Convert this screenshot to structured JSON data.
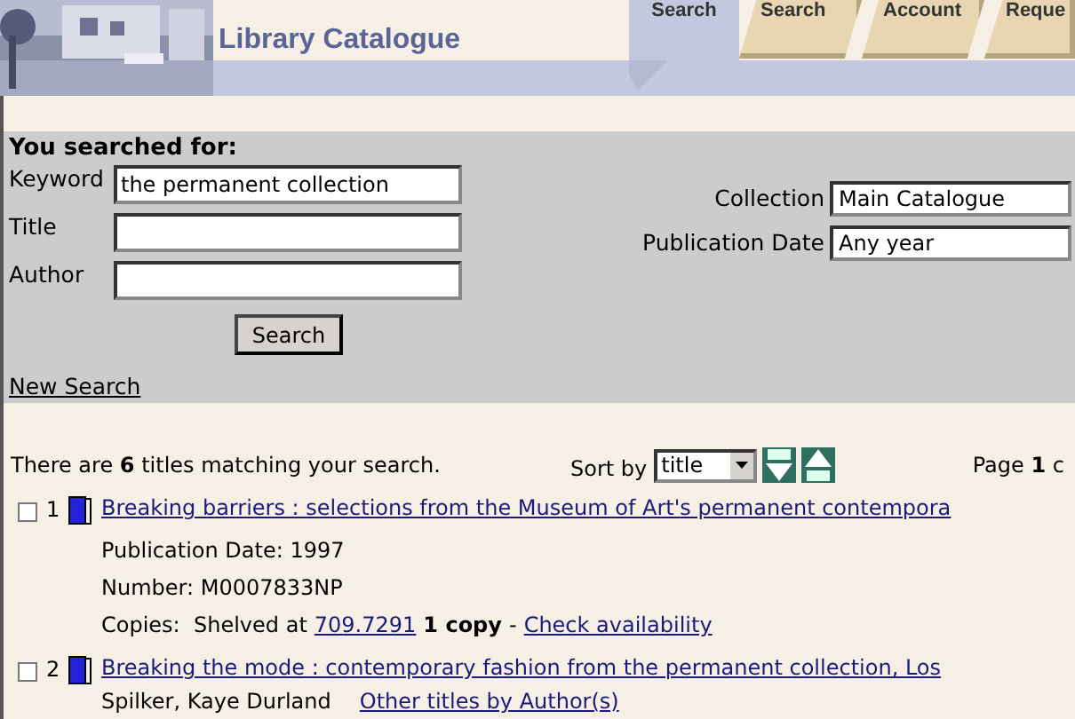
{
  "header": {
    "title": "Library Catalogue",
    "tabs": [
      {
        "label": "Search",
        "selected": true
      },
      {
        "label": "Search",
        "selected": false
      },
      {
        "label": "Account",
        "selected": false
      },
      {
        "label": "Reque",
        "selected": false
      }
    ]
  },
  "search": {
    "heading": "You searched for:",
    "fields": [
      {
        "label": "Keyword",
        "value": "the permanent collection"
      },
      {
        "label": "Title"
      },
      {
        "label": "Author"
      }
    ],
    "button": "Search",
    "selects": [
      {
        "label": "Collection",
        "value": "Main Catalogue"
      },
      {
        "label": "Publication Date",
        "value": "Any year"
      }
    ],
    "new_search": "New Search"
  },
  "results": {
    "summary": "There are **6** titles matching your search.",
    "sort_label": "Sort by",
    "sort_value": "title",
    "page": "Page **1** c",
    "items": [
      {
        "number": "1",
        "checked": false,
        "title": "Breaking barriers : selections from the Museum of Art's permanent contempora",
        "details": [
          "Publication Date: 1997",
          "Number: M0007833NP"
        ],
        "copies": {
          "label": "Copies:  Shelved at",
          "call_number": "709.7291",
          "count": "1 copy",
          "separator": "-",
          "link": "Check availability"
        }
      },
      {
        "number": "2",
        "checked": false,
        "title": "Breaking the mode : contemporary fashion from the permanent collection, Los",
        "author": "Spilker, Kaye Durland",
        "author_link": "Other titles by Author(s)"
      }
    ]
  }
}
